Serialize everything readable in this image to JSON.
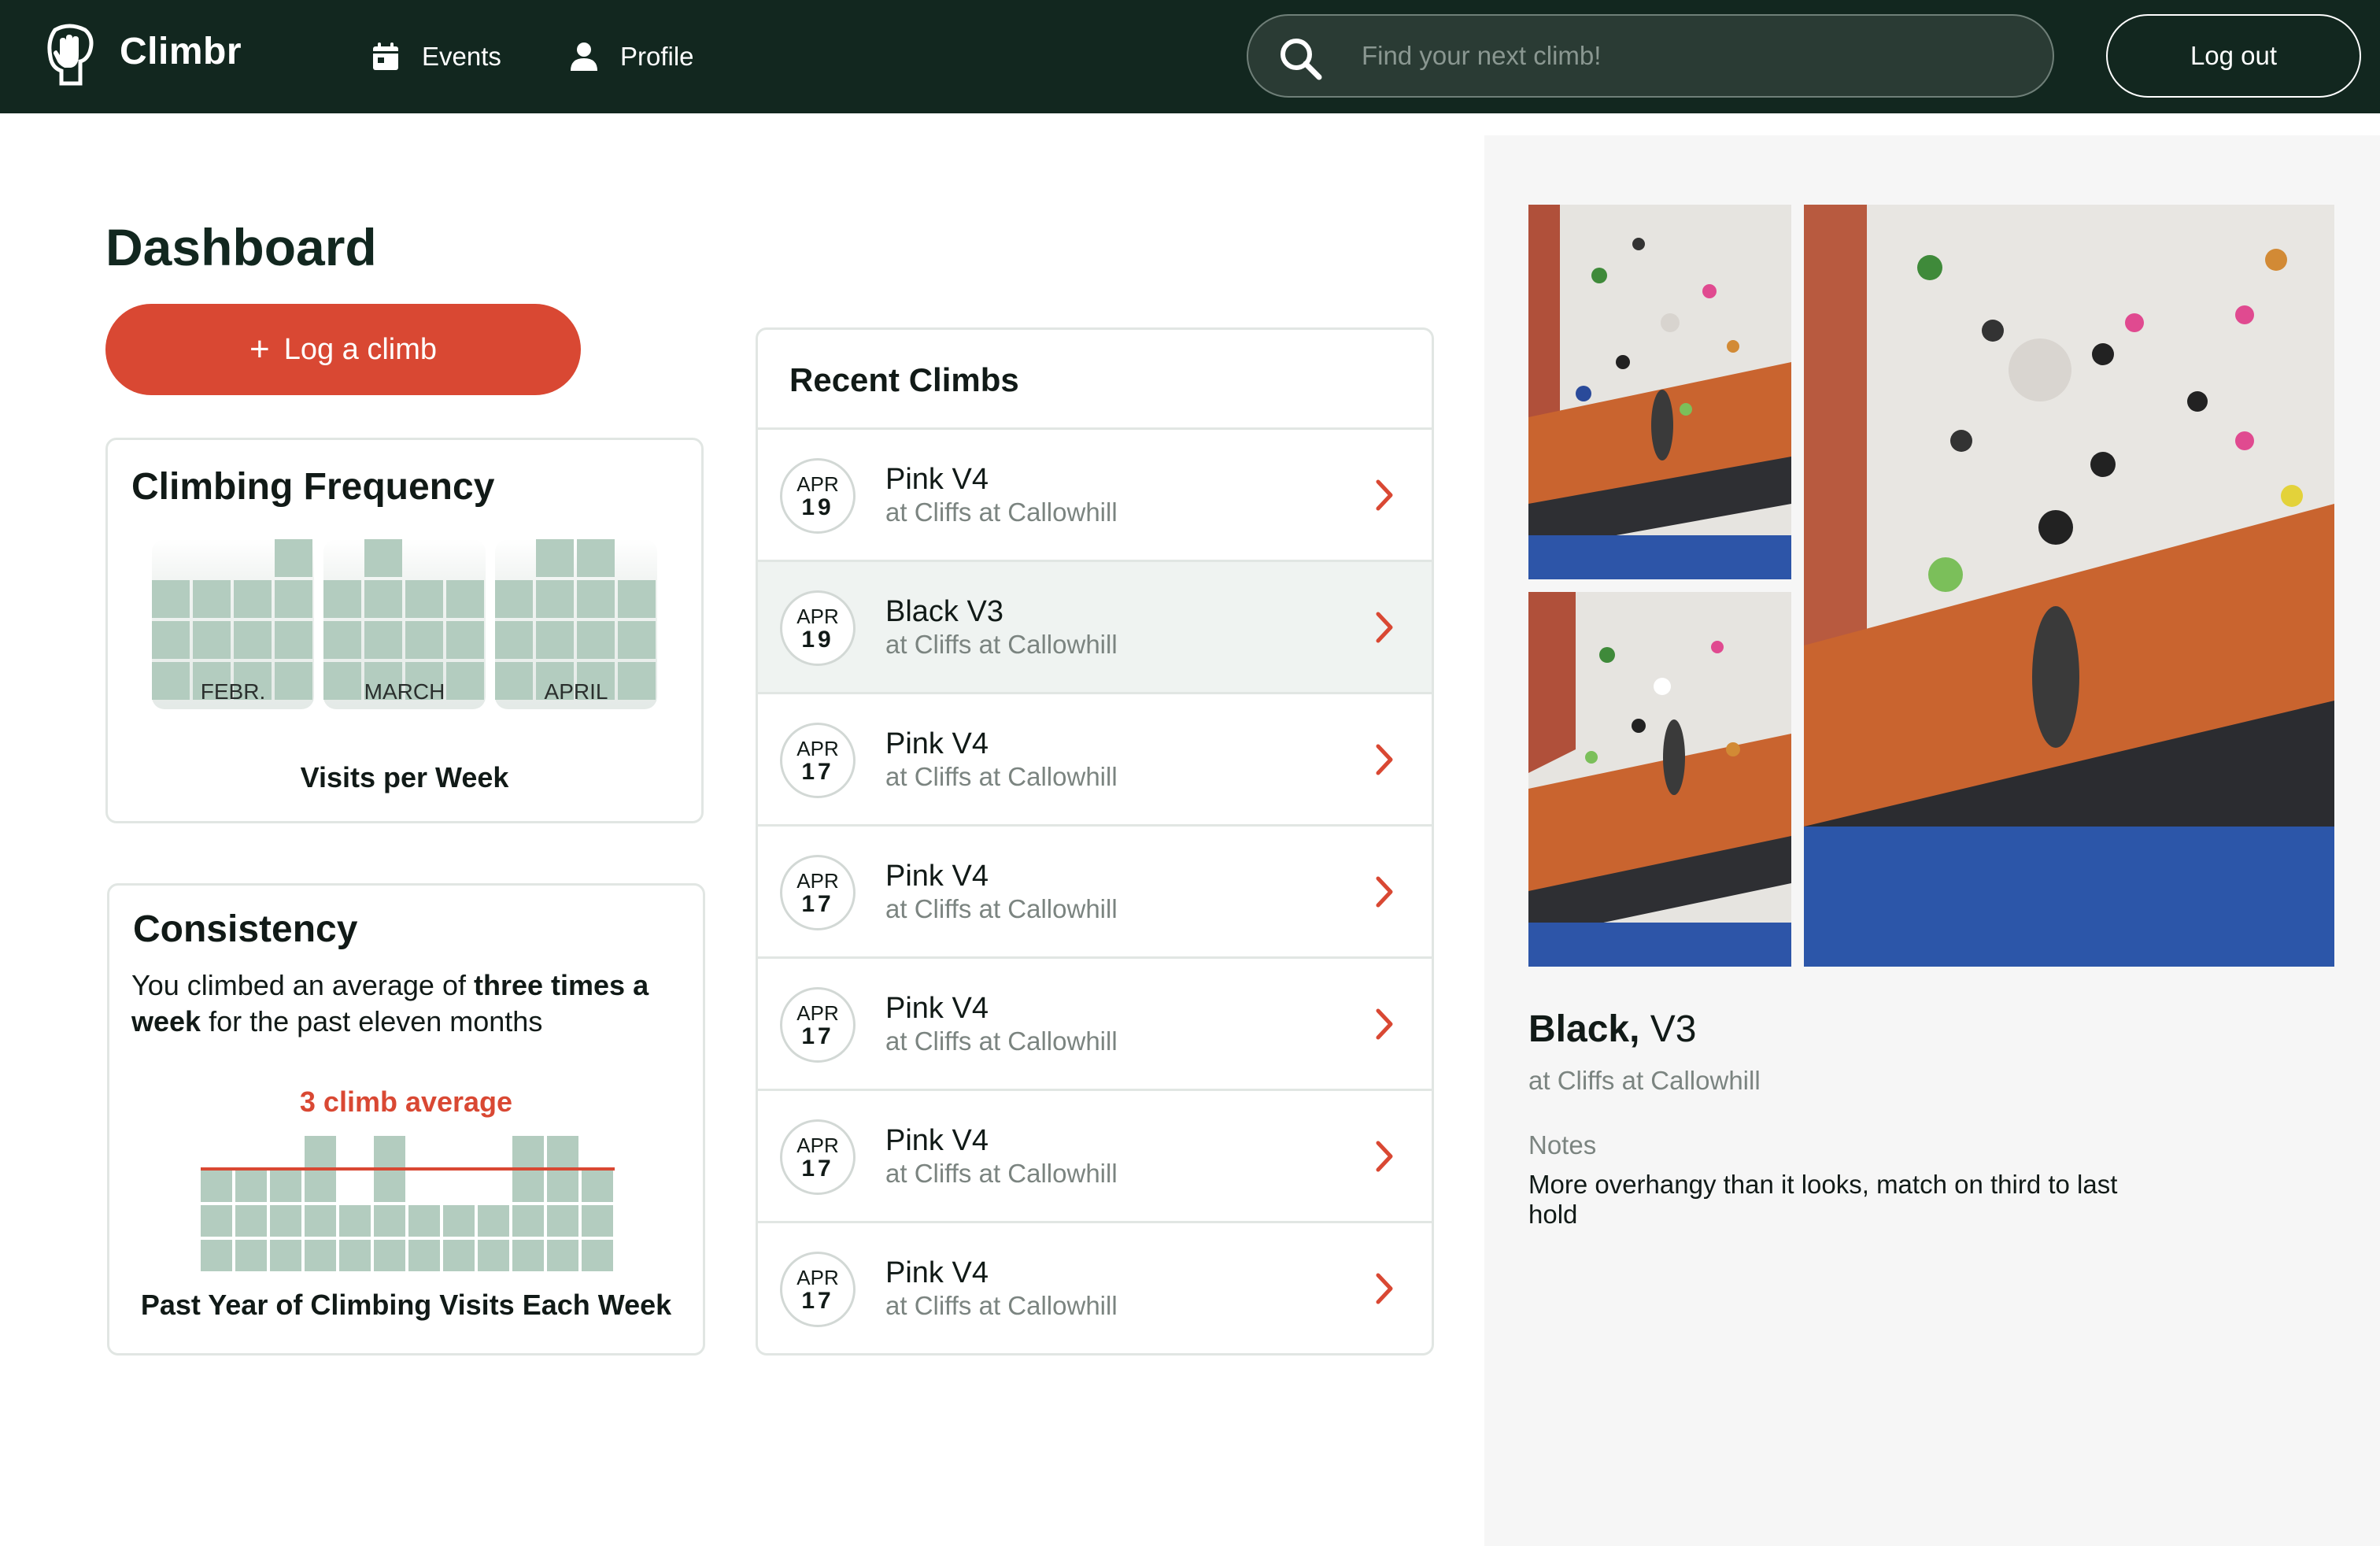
{
  "app": {
    "name": "Climbr"
  },
  "nav": {
    "events_label": "Events",
    "profile_label": "Profile"
  },
  "search": {
    "placeholder": "Find your next climb!"
  },
  "header": {
    "logout_label": "Log out"
  },
  "dashboard": {
    "title": "Dashboard",
    "log_button_label": "Log a climb",
    "log_button_icon": "plus-icon",
    "frequency": {
      "title": "Climbing Frequency",
      "caption": "Visits per Week",
      "months": [
        {
          "label": "FEBR.",
          "weekly_visits": [
            3,
            3,
            3,
            4
          ]
        },
        {
          "label": "MARCH",
          "weekly_visits": [
            3,
            4,
            3,
            3
          ]
        },
        {
          "label": "APRIL",
          "weekly_visits": [
            3,
            4,
            4,
            3
          ]
        }
      ]
    },
    "consistency": {
      "title": "Consistency",
      "text_part1": "You climbed an average of ",
      "text_bold1": "three times a",
      "text_part2": " ",
      "text_bold2": "week",
      "text_part3": " for the past eleven months",
      "average_label": "3 climb average",
      "average_value": 3,
      "caption": "Past Year of Climbing Visits Each Week",
      "weekly_visits": [
        3,
        3,
        3,
        4,
        2,
        4,
        2,
        2,
        2,
        4,
        4,
        3
      ]
    }
  },
  "recent": {
    "title": "Recent Climbs",
    "items": [
      {
        "month": "APR",
        "day": "19",
        "name": "Pink V4",
        "location": "at Cliffs at Callowhill",
        "selected": false
      },
      {
        "month": "APR",
        "day": "19",
        "name": "Black V3",
        "location": "at Cliffs at Callowhill",
        "selected": true
      },
      {
        "month": "APR",
        "day": "17",
        "name": "Pink V4",
        "location": "at Cliffs at Callowhill",
        "selected": false
      },
      {
        "month": "APR",
        "day": "17",
        "name": "Pink V4",
        "location": "at Cliffs at Callowhill",
        "selected": false
      },
      {
        "month": "APR",
        "day": "17",
        "name": "Pink V4",
        "location": "at Cliffs at Callowhill",
        "selected": false
      },
      {
        "month": "APR",
        "day": "17",
        "name": "Pink V4",
        "location": "at Cliffs at Callowhill",
        "selected": false
      },
      {
        "month": "APR",
        "day": "17",
        "name": "Pink V4",
        "location": "at Cliffs at Callowhill",
        "selected": false
      }
    ]
  },
  "detail": {
    "color": "Black,",
    "grade": " V3",
    "location": "at Cliffs at Callowhill",
    "notes_label": "Notes",
    "notes": "More overhangy than it looks, match on third to last hold"
  },
  "colors": {
    "nav_bg": "#12271f",
    "accent": "#d94833",
    "bar": "#b3ccbf",
    "panel_bg": "#f6f6f6"
  }
}
